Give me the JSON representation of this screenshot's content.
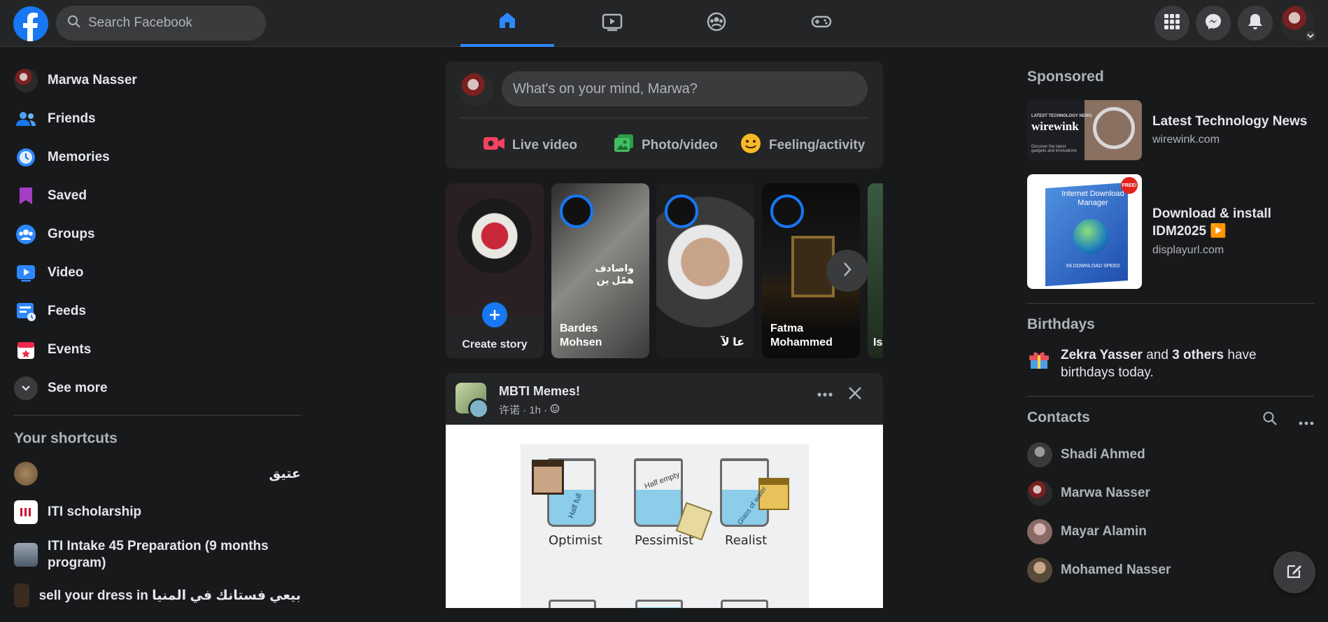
{
  "header": {
    "search_placeholder": "Search Facebook",
    "nav_tabs": [
      "home-icon",
      "video-icon",
      "groups-icon",
      "gaming-icon"
    ],
    "right_buttons": [
      "menu-grid-icon",
      "messenger-icon",
      "bell-icon"
    ]
  },
  "left": {
    "profile_name": "Marwa Nasser",
    "items": [
      {
        "label": "Friends",
        "icon": "friends-icon"
      },
      {
        "label": "Memories",
        "icon": "clock-icon"
      },
      {
        "label": "Saved",
        "icon": "bookmark-icon"
      },
      {
        "label": "Groups",
        "icon": "groups-icon"
      },
      {
        "label": "Video",
        "icon": "video-icon"
      },
      {
        "label": "Feeds",
        "icon": "feeds-icon"
      },
      {
        "label": "Events",
        "icon": "calendar-icon"
      }
    ],
    "see_more": "See more",
    "shortcuts_title": "Your shortcuts",
    "shortcuts": [
      {
        "label": "عتيق"
      },
      {
        "label": "ITI scholarship"
      },
      {
        "label": "ITI Intake 45 Preparation (9 months program)"
      },
      {
        "label": "sell your dress in بيعي فستانك في المنيا"
      }
    ]
  },
  "composer": {
    "placeholder": "What's on your mind, Marwa?",
    "actions": [
      "Live video",
      "Photo/video",
      "Feeling/activity"
    ]
  },
  "stories": {
    "create_label": "Create story",
    "items": [
      {
        "name": "Bardes Mohsen",
        "overlay": "واصادف همّل ين"
      },
      {
        "name": "عا لآ",
        "overlay": ""
      },
      {
        "name": "Fatma Mohammed",
        "overlay": ""
      },
      {
        "name": "Is",
        "overlay": ""
      }
    ]
  },
  "post": {
    "group_name": "MBTI Memes!",
    "meta": "许诺 · 1h ·",
    "meme_labels": [
      "Optimist",
      "Pessimist",
      "Realist"
    ],
    "meme_glass_text": [
      "Half full",
      "Half empty",
      "Glass of water"
    ]
  },
  "right": {
    "sponsored_title": "Sponsored",
    "ads": [
      {
        "title": "Latest Technology News",
        "domain": "wirewink.com",
        "thumb_text": "wirewink",
        "thumb_caption": "LATEST TECHNOLOGY NEWS",
        "thumb_sub": "Discover the latest gadgets and innovations"
      },
      {
        "title": "Download & install IDM2025 ▶️",
        "domain": "displayurl.com",
        "thumb_text": "Internet Download Manager",
        "thumb_sub": "X8 DOWNLOAD SPEED",
        "badge": "FREE!"
      }
    ],
    "birthdays_title": "Birthdays",
    "birthday_name": "Zekra Yasser",
    "birthday_mid": " and ",
    "birthday_others": "3 others",
    "birthday_tail": " have birthdays today.",
    "contacts_title": "Contacts",
    "contacts": [
      "Shadi Ahmed",
      "Marwa Nasser",
      "Mayar Alamin",
      "Mohamed Nasser"
    ]
  }
}
